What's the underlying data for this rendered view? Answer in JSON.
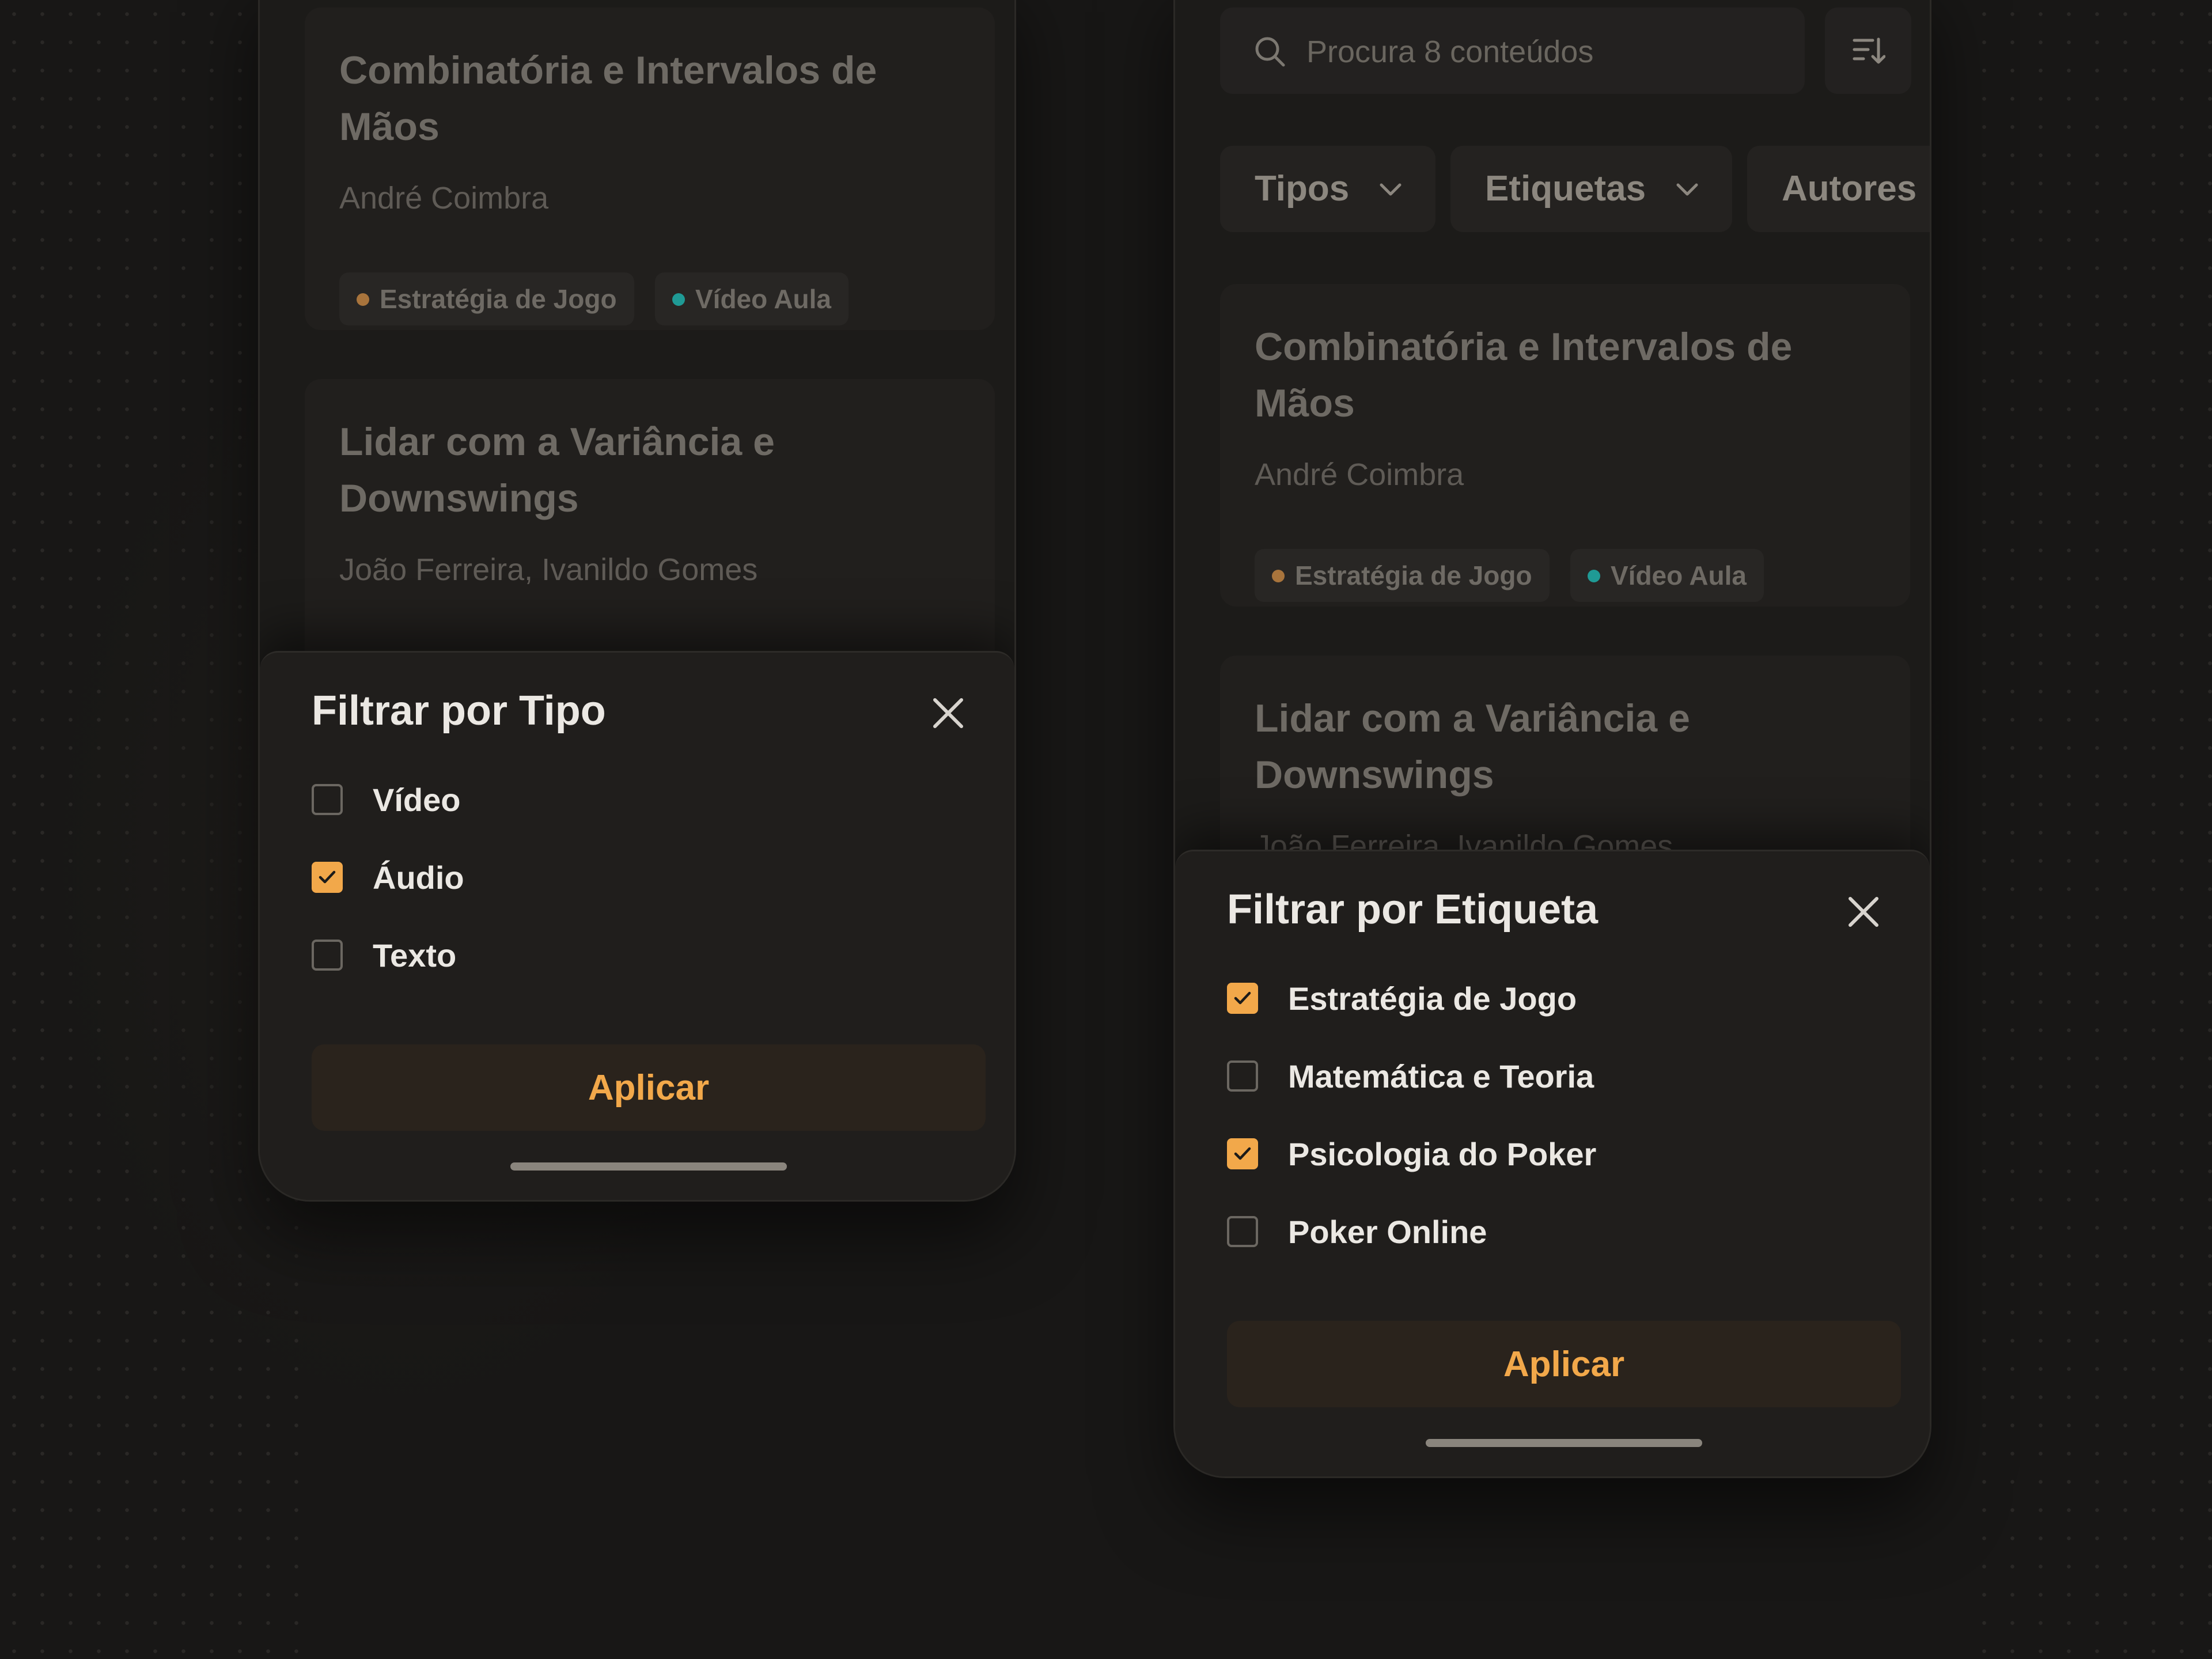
{
  "left_screen": {
    "cards": [
      {
        "title": "Combinatória e Intervalos de Mãos",
        "author": "André Coimbra",
        "tags": [
          {
            "label": "Estratégia de Jogo",
            "color": "#a8743c"
          },
          {
            "label": "Vídeo Aula",
            "color": "#1f9a95"
          }
        ]
      },
      {
        "title": "Lidar com a Variância e Downswings",
        "author": "João Ferreira, Ivanildo Gomes"
      }
    ],
    "sheet": {
      "title": "Filtrar por Tipo",
      "options": [
        {
          "label": "Vídeo",
          "checked": false
        },
        {
          "label": "Áudio",
          "checked": true
        },
        {
          "label": "Texto",
          "checked": false
        }
      ],
      "apply_label": "Aplicar"
    }
  },
  "right_screen": {
    "search": {
      "placeholder": "Procura 8 conteúdos"
    },
    "filter_chips": [
      "Tipos",
      "Etiquetas",
      "Autores"
    ],
    "cards": [
      {
        "title": "Combinatória e Intervalos de Mãos",
        "author": "André Coimbra",
        "tags": [
          {
            "label": "Estratégia de Jogo",
            "color": "#a8743c"
          },
          {
            "label": "Vídeo Aula",
            "color": "#1f9a95"
          }
        ]
      },
      {
        "title": "Lidar com a Variância e Downswings",
        "author": "João Ferreira, Ivanildo Gomes"
      }
    ],
    "sheet": {
      "title": "Filtrar por Etiqueta",
      "options": [
        {
          "label": "Estratégia de Jogo",
          "checked": true
        },
        {
          "label": "Matemática e Teoria",
          "checked": false
        },
        {
          "label": "Psicologia do Poker",
          "checked": true
        },
        {
          "label": "Poker Online",
          "checked": false
        }
      ],
      "apply_label": "Aplicar"
    }
  },
  "colors": {
    "accent": "#f2a84a",
    "background": "#181716",
    "sheet": "#201e1c"
  }
}
